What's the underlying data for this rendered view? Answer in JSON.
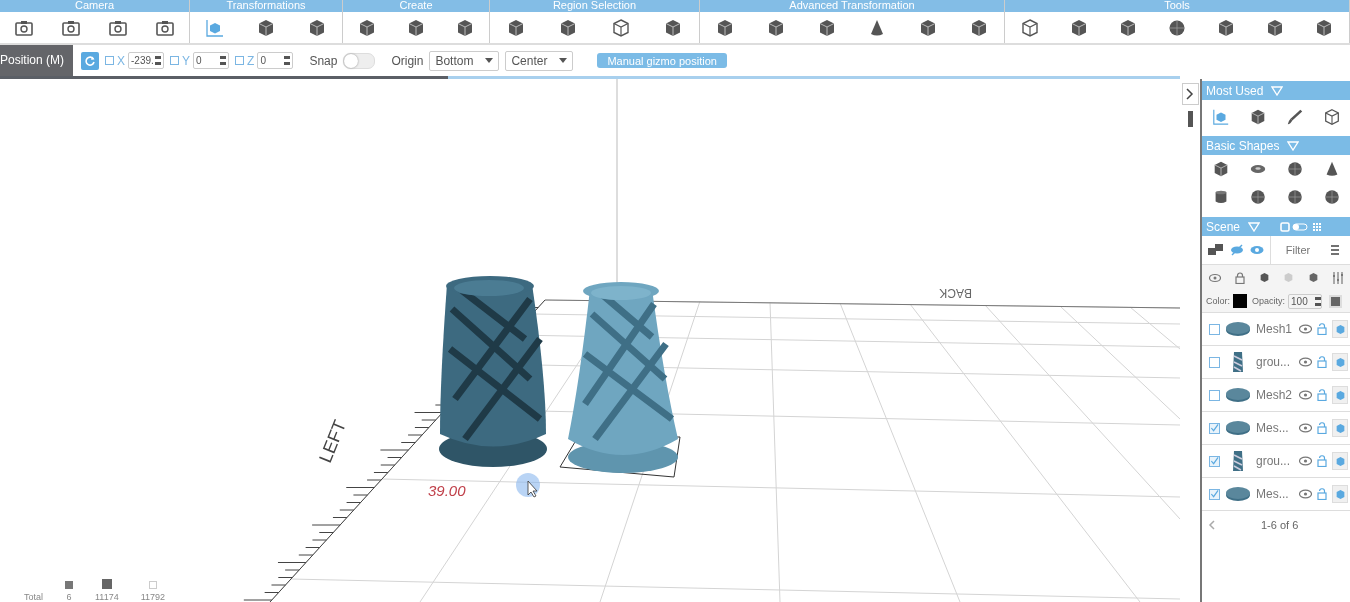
{
  "ribbon": {
    "groups": [
      {
        "title": "Camera"
      },
      {
        "title": "Transformations"
      },
      {
        "title": "Create"
      },
      {
        "title": "Region Selection"
      },
      {
        "title": "Advanced Transformation"
      },
      {
        "title": "Tools"
      }
    ]
  },
  "toolbar": {
    "mode_tab": "Position (M)",
    "axes": [
      {
        "label": "X",
        "checked": false,
        "value": "-239."
      },
      {
        "label": "Y",
        "checked": false,
        "value": "0"
      },
      {
        "label": "Z",
        "checked": false,
        "value": "0"
      }
    ],
    "snap": {
      "label": "Snap",
      "on": false
    },
    "origin": {
      "label": "Origin",
      "selects": [
        {
          "value": "Bottom"
        },
        {
          "value": "Center"
        }
      ]
    },
    "gizmo_button": "Manual gizmo position"
  },
  "progress": {
    "level": 0.38
  },
  "viewport": {
    "axis_labels": [
      {
        "text": "LEFT",
        "kind": "left"
      },
      {
        "text": "BACK",
        "kind": "back"
      }
    ],
    "dimension": "39.00",
    "stats": {
      "label": "Total",
      "values": [
        "6",
        "11174",
        "11792"
      ]
    }
  },
  "panel": {
    "sections": [
      {
        "title": "Most Used"
      },
      {
        "title": "Basic Shapes"
      }
    ],
    "scene": {
      "title": "Scene",
      "filter_placeholder": "Filter",
      "color_label": "Color:",
      "color": "#000000",
      "opacity_label": "Opacity:",
      "opacity": "100",
      "items": [
        {
          "name": "Mesh1",
          "checked": false,
          "kind": "mesh"
        },
        {
          "name": "grou...",
          "checked": false,
          "kind": "group"
        },
        {
          "name": "Mesh2",
          "checked": false,
          "kind": "mesh"
        },
        {
          "name": "Mes...",
          "checked": true,
          "kind": "mesh"
        },
        {
          "name": "grou...",
          "checked": true,
          "kind": "group"
        },
        {
          "name": "Mes...",
          "checked": true,
          "kind": "mesh"
        }
      ],
      "pagination": "1-6 of 6"
    }
  }
}
